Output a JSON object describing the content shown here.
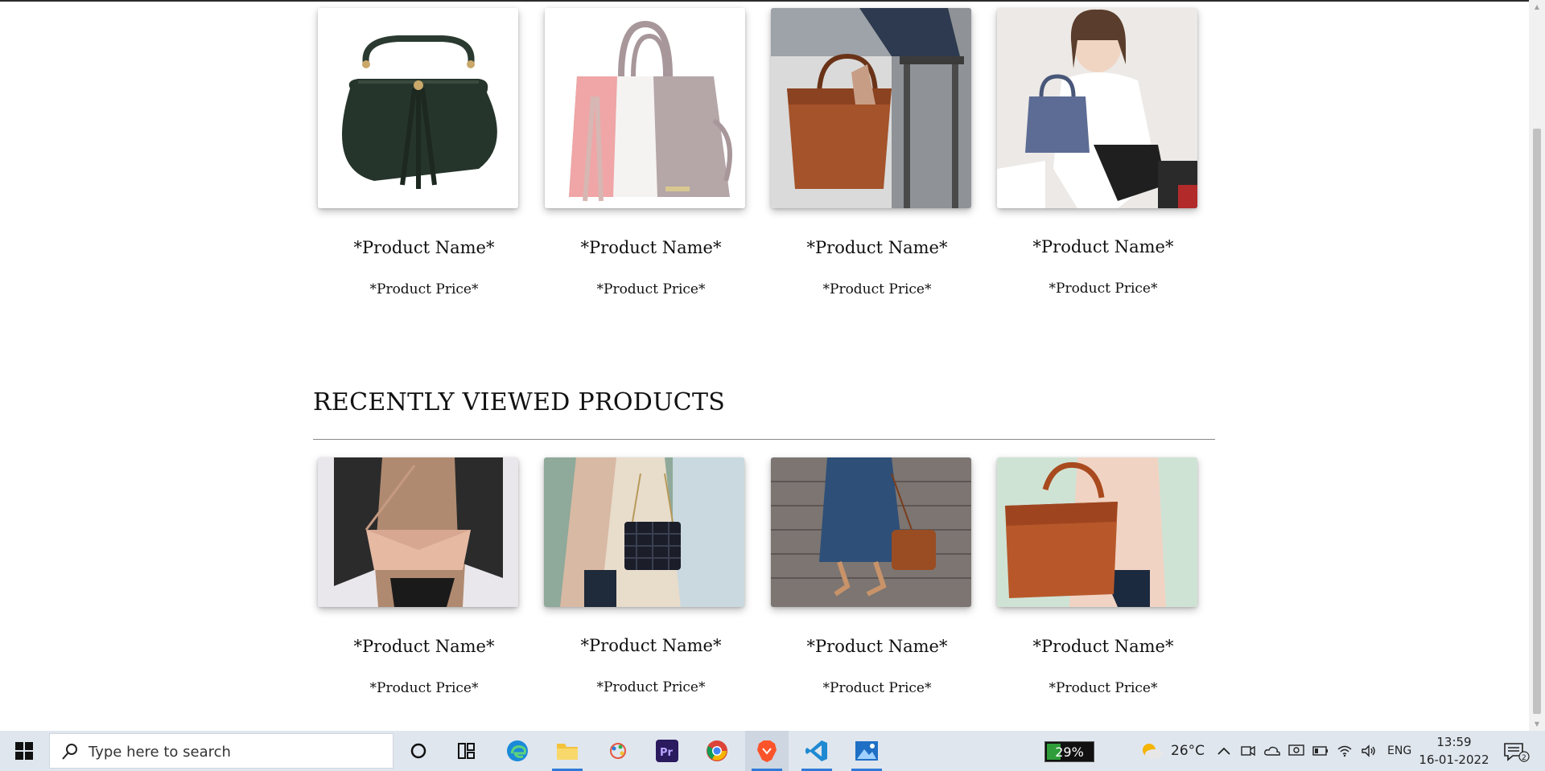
{
  "products_top": [
    {
      "name": "*Product Name*",
      "price": "*Product Price*",
      "image": "green-bucket-bag"
    },
    {
      "name": "*Product Name*",
      "price": "*Product Price*",
      "image": "pink-white-tote"
    },
    {
      "name": "*Product Name*",
      "price": "*Product Price*",
      "image": "brown-leather-tote"
    },
    {
      "name": "*Product Name*",
      "price": "*Product Price*",
      "image": "model-with-blue-bag"
    }
  ],
  "recently_viewed": {
    "title": "RECENTLY VIEWED PRODUCTS",
    "products": [
      {
        "name": "*Product Name*",
        "price": "*Product Price*",
        "image": "beige-crossbody"
      },
      {
        "name": "*Product Name*",
        "price": "*Product Price*",
        "image": "quilted-black-bag"
      },
      {
        "name": "*Product Name*",
        "price": "*Product Price*",
        "image": "cognac-handbag-street"
      },
      {
        "name": "*Product Name*",
        "price": "*Product Price*",
        "image": "orange-shoulder-bag"
      }
    ]
  },
  "taskbar": {
    "search_placeholder": "Type here to search",
    "battery": "29%",
    "temperature": "26°C",
    "language": "ENG",
    "time": "13:59",
    "date": "16-01-2022",
    "notification_count": "2",
    "apps": [
      "cortana-icon",
      "task-view-icon",
      "edge-icon",
      "file-explorer-icon",
      "paint-icon",
      "premiere-pro-icon",
      "chrome-icon",
      "brave-icon",
      "vscode-icon",
      "photos-icon"
    ]
  },
  "colors": {
    "accent": "#2f7ad9",
    "taskbar_bg": "#dfe6ee",
    "divider": "#888888"
  }
}
